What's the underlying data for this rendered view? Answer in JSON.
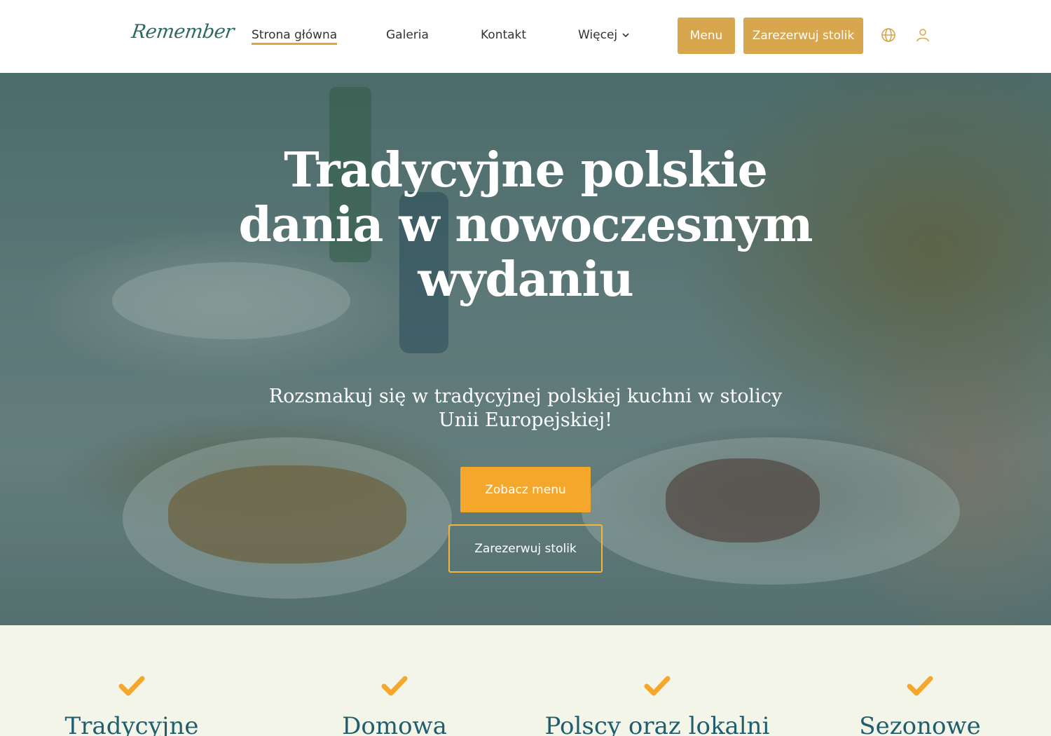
{
  "header": {
    "logo": "Remember",
    "nav": {
      "home": "Strona główna",
      "gallery": "Galeria",
      "contact": "Kontakt",
      "more": "Więcej"
    },
    "buttons": {
      "menu": "Menu",
      "reserve": "Zarezerwuj stolik"
    },
    "icons": [
      "globe-icon",
      "user-icon",
      "chevron-down-icon"
    ]
  },
  "hero": {
    "title": "Tradycyjne polskie dania w nowoczesnym wydaniu",
    "subtitle": "Rozsmakuj się w tradycyjnej polskiej kuchni w stolicy Unii Europejskiej!",
    "primary_cta": "Zobacz menu",
    "secondary_cta": "Zarezerwuj stolik"
  },
  "features": [
    {
      "title": "Tradycyjne",
      "icon": "check-icon"
    },
    {
      "title": "Domowa",
      "icon": "check-icon"
    },
    {
      "title": "Polscy oraz lokalni",
      "icon": "check-icon"
    },
    {
      "title": "Sezonowe",
      "icon": "check-icon"
    }
  ],
  "colors": {
    "accent": "#d7a64d",
    "cta": "#f4a72a",
    "nav_underline": "#e0a53b",
    "logo": "#2f6a60",
    "feature_title": "#1f5e6e",
    "feature_background": "#f3f5e8"
  }
}
